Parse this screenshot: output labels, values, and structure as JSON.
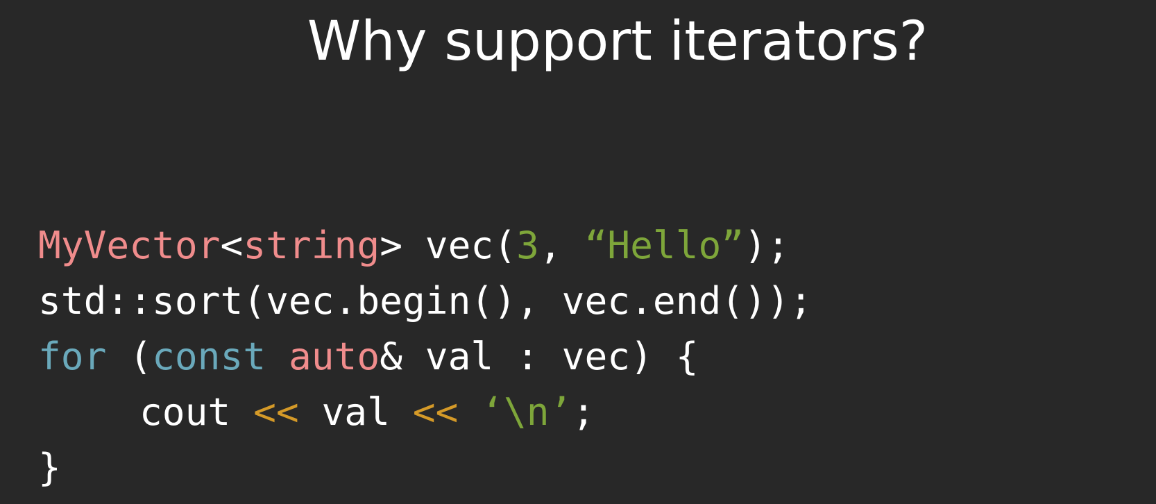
{
  "slide": {
    "title": "Why support iterators?"
  },
  "colors": {
    "background": "#282828",
    "plain": "#ffffff",
    "type": "#f08c8c",
    "keyword": "#6aa9bb",
    "literal": "#7ea63a",
    "operator": "#d59a28"
  },
  "code": {
    "lines": [
      {
        "indent": false,
        "tokens": [
          {
            "text": "MyVector",
            "kind": "type"
          },
          {
            "text": "<",
            "kind": "plain"
          },
          {
            "text": "string",
            "kind": "type"
          },
          {
            "text": "> vec(",
            "kind": "plain"
          },
          {
            "text": "3",
            "kind": "literal"
          },
          {
            "text": ", ",
            "kind": "plain"
          },
          {
            "text": "“Hello”",
            "kind": "literal"
          },
          {
            "text": ");",
            "kind": "plain"
          }
        ]
      },
      {
        "indent": false,
        "tokens": [
          {
            "text": "std::sort(vec.begin(), vec.end());",
            "kind": "plain"
          }
        ]
      },
      {
        "indent": false,
        "tokens": [
          {
            "text": "for",
            "kind": "keyword"
          },
          {
            "text": " (",
            "kind": "plain"
          },
          {
            "text": "const",
            "kind": "keyword"
          },
          {
            "text": " ",
            "kind": "plain"
          },
          {
            "text": "auto",
            "kind": "type"
          },
          {
            "text": "& val : vec) {",
            "kind": "plain"
          }
        ]
      },
      {
        "indent": true,
        "tokens": [
          {
            "text": "cout ",
            "kind": "plain"
          },
          {
            "text": "<<",
            "kind": "operator"
          },
          {
            "text": " val ",
            "kind": "plain"
          },
          {
            "text": "<<",
            "kind": "operator"
          },
          {
            "text": " ",
            "kind": "plain"
          },
          {
            "text": "‘\\n’",
            "kind": "literal"
          },
          {
            "text": ";",
            "kind": "plain"
          }
        ]
      },
      {
        "indent": false,
        "tokens": [
          {
            "text": "}",
            "kind": "plain"
          }
        ]
      }
    ]
  }
}
